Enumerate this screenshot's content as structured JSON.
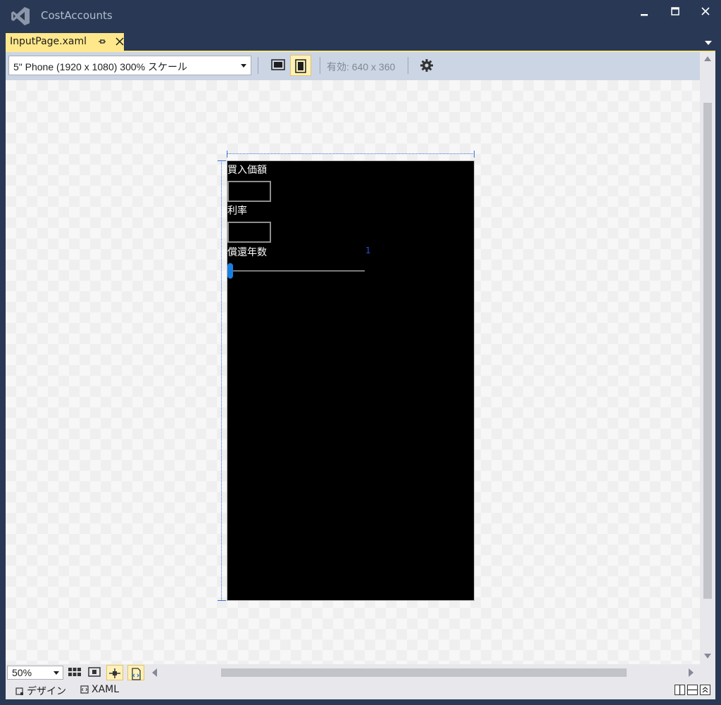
{
  "window": {
    "title": "CostAccounts"
  },
  "tab": {
    "label": "InputPage.xaml"
  },
  "toolbar": {
    "device": "5\" Phone (1920 x 1080) 300% スケール",
    "effective": "有効: 640 x 360"
  },
  "phone": {
    "label_purchase": "買入価額",
    "label_rate": "利率",
    "label_years": "償還年数",
    "slider_value": "1"
  },
  "bottom": {
    "zoom": "50%",
    "design_tab": "デザイン",
    "xaml_tab": "XAML"
  },
  "colors": {
    "frame": "#293955",
    "tab_active": "#ffe88c",
    "toolbar": "#ccd5e4",
    "accent": "#1a7fe0"
  }
}
